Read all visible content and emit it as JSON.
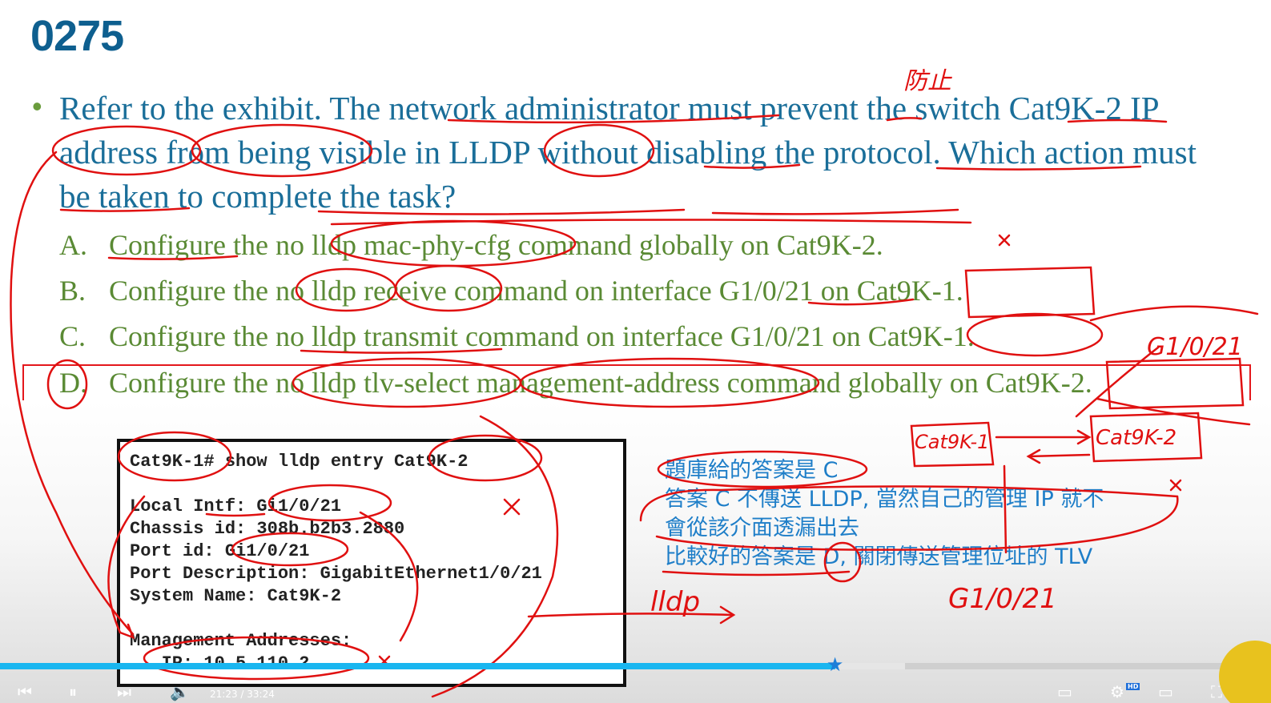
{
  "slide": {
    "title": "0275",
    "question": "Refer to the exhibit. The network administrator must prevent the switch Cat9K-2 IP address from being visible in LLDP without disabling the protocol. Which action must be taken to complete the task?",
    "options": [
      {
        "letter": "A.",
        "text": "Configure the no lldp mac-phy-cfg command globally on Cat9K-2."
      },
      {
        "letter": "B.",
        "text": "Configure the no lldp receive command on interface G1/0/21 on Cat9K-1."
      },
      {
        "letter": "C.",
        "text": "Configure the no lldp transmit command on interface G1/0/21 on Cat9K-1."
      },
      {
        "letter": "D.",
        "text": "Configure the no lldp tlv-select management-address command globally on Cat9K-2."
      }
    ]
  },
  "exhibit": {
    "lines": [
      "Cat9K-1# show lldp entry Cat9K-2",
      "",
      "Local Intf: Gi1/0/21",
      "Chassis id: 308b.b2b3.2880",
      "Port id: Gi1/0/21",
      "Port Description: GigabitEthernet1/0/21",
      "System Name: Cat9K-2",
      "",
      "Management Addresses:",
      "   IP: 10.5.110.2"
    ]
  },
  "annotations": {
    "note_lines": [
      "題庫給的答案是 C",
      "答案 C 不傳送 LLDP, 當然自己的管理 IP 就不",
      "會從該介面透漏出去",
      "比較好的答案是 D, 關閉傳送管理位址的 TLV"
    ],
    "handwritten": {
      "prevent": "防止",
      "lldp": "lldp",
      "switch_left": "Cat9K-1",
      "switch_right": "Cat9K-2",
      "port_top": "G1/0/21",
      "port_bottom": "G1/0/21"
    },
    "ink_color": "#e01010"
  },
  "player": {
    "time": "21:23 / 33:24",
    "progress": 0.657,
    "buffered": 0.712,
    "hd_badge": "HD",
    "played_color": "#19b6f0"
  }
}
